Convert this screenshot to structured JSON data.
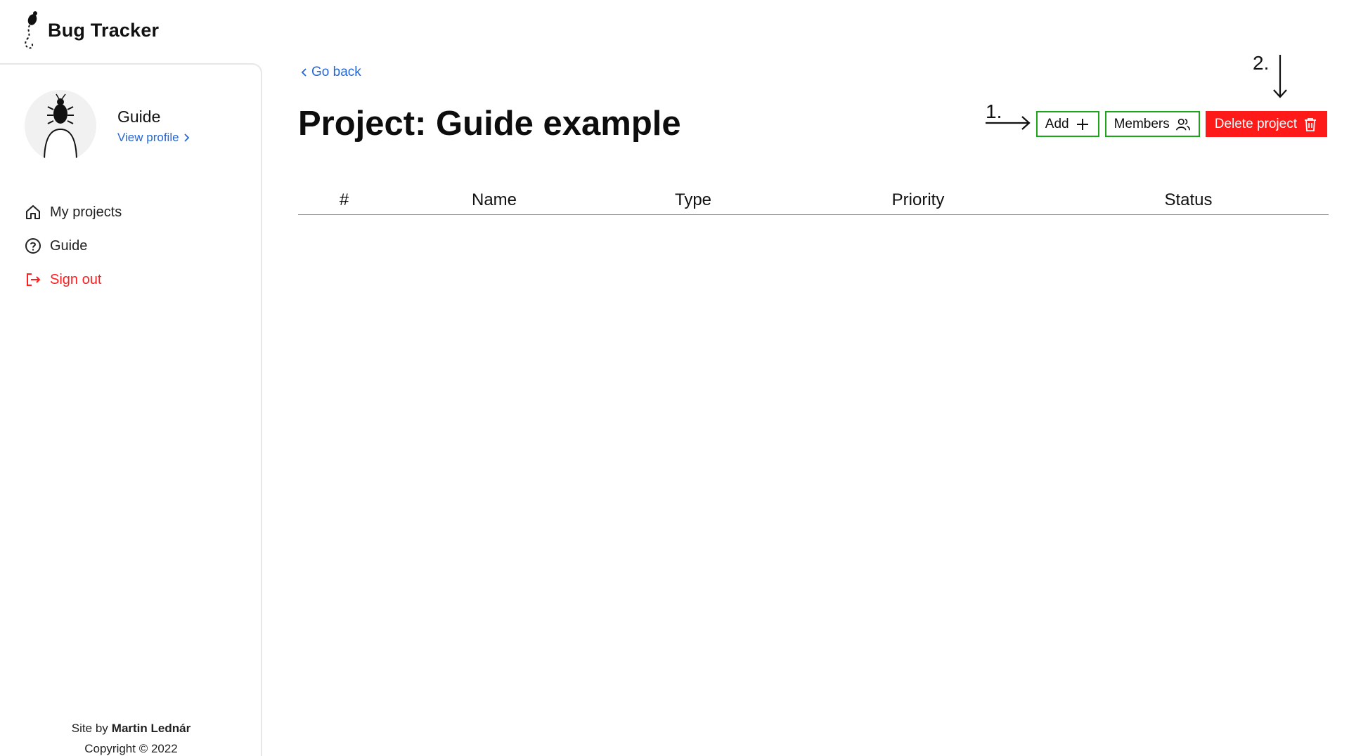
{
  "app": {
    "title": "Bug Tracker"
  },
  "profile": {
    "name": "Guide",
    "view_profile_label": "View profile"
  },
  "nav": {
    "items": [
      {
        "label": "My projects",
        "icon": "home-icon"
      },
      {
        "label": "Guide",
        "icon": "help-circle-icon"
      },
      {
        "label": "Sign out",
        "icon": "sign-out-icon"
      }
    ]
  },
  "footer": {
    "site_by_prefix": "Site by",
    "author": "Martin Lednár",
    "copyright": "Copyright © 2022"
  },
  "main": {
    "go_back_label": "Go back",
    "title": "Project: Guide example",
    "actions": {
      "add_label": "Add",
      "members_label": "Members",
      "delete_label": "Delete project"
    },
    "annotations": {
      "first": "1.",
      "second": "2."
    },
    "table": {
      "columns": [
        "#",
        "Name",
        "Type",
        "Priority",
        "Status"
      ],
      "rows": []
    }
  },
  "colors": {
    "link": "#2566d8",
    "danger": "#ff1a1a",
    "success_border": "#1aa51a",
    "signout": "#ff1f1f"
  }
}
